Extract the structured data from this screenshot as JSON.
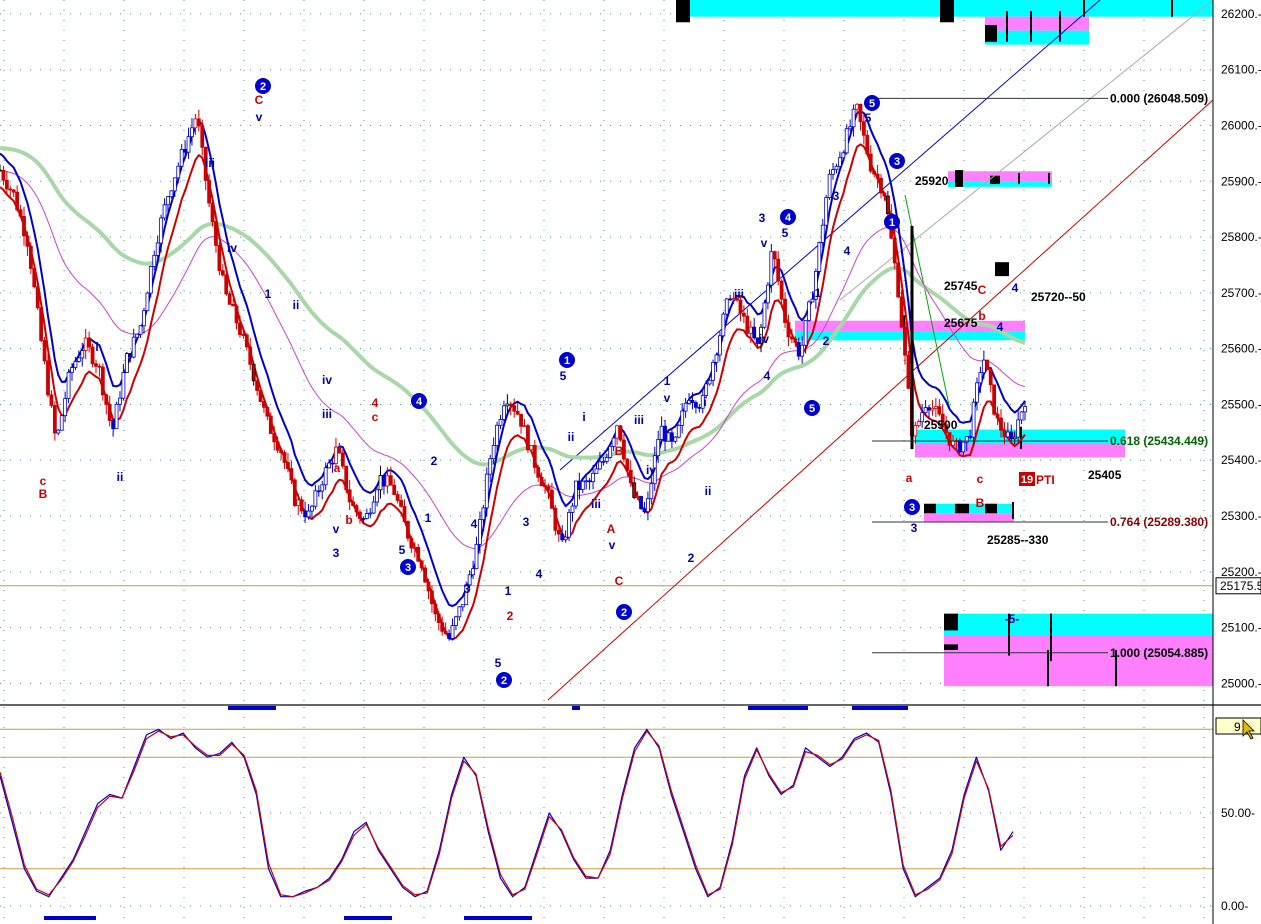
{
  "chart_data": [
    {
      "type": "candlestick",
      "panel": "price",
      "ylim": [
        24990,
        26250
      ],
      "y_ticks": [
        25000,
        25100,
        25200,
        25300,
        25400,
        25500,
        25600,
        25700,
        25800,
        25900,
        26000,
        26100,
        26200
      ],
      "y_tick_labels": [
        "25000.-",
        "25100.-",
        "25200.-",
        "25300.-",
        "25400.-",
        "25500.-",
        "25600.-",
        "25700.-",
        "25800.-",
        "25900.-",
        "26000.-",
        "26100.-",
        "26200.-"
      ],
      "current_price_label": "25175.5",
      "current_price": 25175,
      "grid": true,
      "path": [
        25920,
        25875,
        25790,
        25600,
        25430,
        25560,
        25610,
        25570,
        25450,
        25580,
        25640,
        25780,
        25880,
        25950,
        26020,
        25840,
        25700,
        25640,
        25560,
        25470,
        25420,
        25330,
        25300,
        25370,
        25420,
        25320,
        25290,
        25370,
        25350,
        25270,
        25220,
        25120,
        25080,
        25150,
        25250,
        25420,
        25520,
        25480,
        25400,
        25340,
        25240,
        25350,
        25360,
        25400,
        25470,
        25340,
        25300,
        25460,
        25420,
        25520,
        25500,
        25600,
        25700,
        25650,
        25600,
        25780,
        25640,
        25590,
        25720,
        25900,
        25960,
        26030,
        25930,
        25880,
        25700,
        25440,
        25510,
        25470,
        25420,
        25440,
        25590,
        25470,
        25430,
        25510
      ],
      "price_labels": [
        {
          "text": "0.000 (26048.509)",
          "value": 26048.509,
          "color": "#000000"
        },
        {
          "text": "0.618 (25434.449)",
          "value": 25434.449,
          "color": "#006400"
        },
        {
          "text": "0.764 (25289.380)",
          "value": 25289.38,
          "color": "#8b0000"
        },
        {
          "text": "1.000 (25054.885)",
          "value": 25054.885,
          "color": "#000000"
        },
        {
          "text": "25920",
          "value": 25920,
          "color": "#000000"
        },
        {
          "text": "25745",
          "value": 25745,
          "color": "#000000"
        },
        {
          "text": "25720--50",
          "value": 25720,
          "color": "#000000"
        },
        {
          "text": "25675",
          "value": 25675,
          "color": "#000000"
        },
        {
          "text": "25405",
          "value": 25405,
          "color": "#000000"
        },
        {
          "text": "25285--330",
          "value": 25285,
          "color": "#000000"
        },
        {
          "text": "25500",
          "value": 25490,
          "color": "#000000"
        }
      ],
      "wave_labels": [
        {
          "text": "c",
          "color": "#cc0000"
        },
        {
          "text": "B",
          "color": "#cc0000"
        },
        {
          "text": "i",
          "color": "#0000aa"
        },
        {
          "text": "ii",
          "color": "#0000aa"
        },
        {
          "text": "iii",
          "color": "#0000aa"
        },
        {
          "text": "iv",
          "color": "#0000aa"
        },
        {
          "text": "v",
          "color": "#0000aa"
        },
        {
          "text": "C",
          "color": "#cc0000"
        },
        {
          "text": "1",
          "color": "#0000aa"
        },
        {
          "text": "ii",
          "color": "#0000aa"
        },
        {
          "text": "iv",
          "color": "#0000aa"
        },
        {
          "text": "iii",
          "color": "#0000aa"
        },
        {
          "text": "4",
          "color": "#cc0000"
        },
        {
          "text": "c",
          "color": "#cc0000"
        },
        {
          "text": "a",
          "color": "#cc0000"
        },
        {
          "text": "b",
          "color": "#cc0000"
        },
        {
          "text": "v",
          "color": "#0000aa"
        },
        {
          "text": "3",
          "color": "#0000aa"
        },
        {
          "text": "5",
          "color": "#0000aa"
        },
        {
          "text": "2",
          "color": "#0000aa"
        },
        {
          "text": "1",
          "color": "#0000aa"
        },
        {
          "text": "4",
          "color": "#0000aa"
        },
        {
          "text": "3",
          "color": "#0000aa"
        },
        {
          "text": "5",
          "color": "#0000aa"
        },
        {
          "text": "1",
          "color": "#0000aa"
        },
        {
          "text": "2",
          "color": "#cc0000"
        },
        {
          "text": "3",
          "color": "#0000aa"
        },
        {
          "text": "4",
          "color": "#0000aa"
        },
        {
          "text": "5",
          "color": "#0000aa"
        },
        {
          "text": "i",
          "color": "#0000aa"
        },
        {
          "text": "ii",
          "color": "#0000aa"
        },
        {
          "text": "iii",
          "color": "#0000aa"
        },
        {
          "text": "v",
          "color": "#0000aa"
        },
        {
          "text": "A",
          "color": "#cc0000"
        },
        {
          "text": "B",
          "color": "#cc0000"
        },
        {
          "text": "C",
          "color": "#cc0000"
        },
        {
          "text": "iii",
          "color": "#0000aa"
        },
        {
          "text": "iv",
          "color": "#0000aa"
        },
        {
          "text": "1",
          "color": "#0000aa"
        },
        {
          "text": "v",
          "color": "#0000aa"
        },
        {
          "text": "i",
          "color": "#0000aa"
        },
        {
          "text": "ii",
          "color": "#0000aa"
        },
        {
          "text": "2",
          "color": "#0000aa"
        },
        {
          "text": "iii",
          "color": "#0000aa"
        },
        {
          "text": "iv",
          "color": "#0000aa"
        },
        {
          "text": "4",
          "color": "#0000aa"
        },
        {
          "text": "v",
          "color": "#0000aa"
        },
        {
          "text": "3",
          "color": "#0000aa"
        },
        {
          "text": "5",
          "color": "#0000aa"
        },
        {
          "text": "1",
          "color": "#0000aa"
        },
        {
          "text": "2",
          "color": "#0000aa"
        },
        {
          "text": "4",
          "color": "#0000aa"
        },
        {
          "text": "3",
          "color": "#0000aa"
        },
        {
          "text": "5",
          "color": "#0000aa"
        },
        {
          "text": "a",
          "color": "#cc0000"
        },
        {
          "text": "c",
          "color": "#cc0000"
        },
        {
          "text": "b",
          "color": "#cc0000"
        },
        {
          "text": "4",
          "color": "#0000aa"
        },
        {
          "text": "C",
          "color": "#cc0000"
        },
        {
          "text": "4",
          "color": "#0000aa"
        },
        {
          "text": "B",
          "color": "#cc0000"
        },
        {
          "text": "3",
          "color": "#0000aa"
        },
        {
          "text": "-5-",
          "color": "#0000aa"
        }
      ],
      "circle_labels": [
        "2",
        "4",
        "3",
        "5",
        "1",
        "2",
        "3",
        "4",
        "5",
        "2",
        "1",
        "3"
      ],
      "pti_label": {
        "number": "19",
        "text": "PTI"
      }
    },
    {
      "type": "line",
      "panel": "oscillator",
      "ylim": [
        0,
        100
      ],
      "y_ticks": [
        0,
        50
      ],
      "y_tick_labels": [
        "0.00-",
        "50.00-"
      ],
      "corner_value": "9",
      "levels": [
        20,
        80,
        95
      ],
      "series": [
        {
          "color": "#0000cc",
          "values": [
            70,
            45,
            20,
            8,
            5,
            15,
            25,
            40,
            55,
            60,
            58,
            75,
            92,
            95,
            90,
            93,
            85,
            80,
            82,
            88,
            80,
            60,
            20,
            5,
            5,
            8,
            10,
            15,
            25,
            40,
            45,
            30,
            20,
            10,
            5,
            8,
            30,
            60,
            80,
            70,
            40,
            15,
            5,
            10,
            30,
            50,
            40,
            25,
            15,
            15,
            30,
            60,
            85,
            95,
            85,
            60,
            40,
            20,
            5,
            10,
            35,
            70,
            85,
            70,
            60,
            65,
            85,
            80,
            75,
            80,
            90,
            93,
            88,
            60,
            20,
            5,
            10,
            15,
            30,
            60,
            80,
            62,
            30,
            40
          ]
        },
        {
          "color": "#cc0000",
          "values": [
            72,
            48,
            22,
            9,
            6,
            14,
            24,
            38,
            53,
            59,
            58,
            73,
            90,
            94,
            91,
            92,
            86,
            81,
            81,
            87,
            81,
            62,
            23,
            6,
            5,
            7,
            10,
            14,
            24,
            38,
            44,
            31,
            21,
            11,
            6,
            7,
            28,
            58,
            78,
            71,
            42,
            17,
            6,
            9,
            28,
            48,
            41,
            26,
            16,
            15,
            28,
            58,
            83,
            94,
            86,
            62,
            42,
            22,
            6,
            9,
            33,
            68,
            84,
            71,
            61,
            64,
            83,
            81,
            76,
            79,
            89,
            92,
            89,
            62,
            22,
            6,
            9,
            14,
            28,
            58,
            78,
            63,
            32,
            38
          ]
        }
      ]
    }
  ]
}
